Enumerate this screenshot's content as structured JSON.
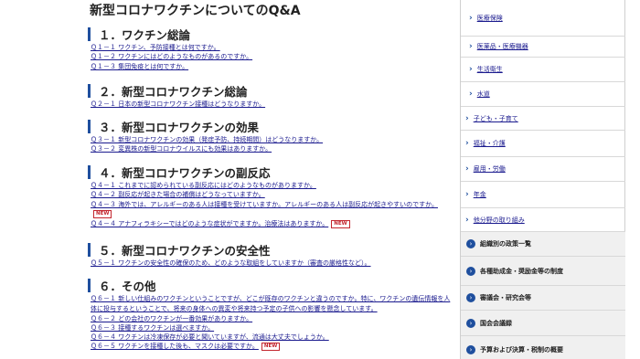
{
  "page_title": "新型コロナワクチンについてのQ&A",
  "new_badge": "NEW",
  "sections": [
    {
      "title": "１．ワクチン総論",
      "items": [
        "Ｑ１－１ ワクチン、予防接種とは何ですか。",
        "Ｑ１－２ ワクチンにはどのようなものがあるのですか。",
        "Ｑ１－３ 集団免疫とは何ですか。"
      ]
    },
    {
      "title": "２．新型コロナワクチン総論",
      "items": [
        "Ｑ２－１ 日本の新型コロナワクチン接種はどうなりますか。"
      ]
    },
    {
      "title": "３．新型コロナワクチンの効果",
      "items": [
        "Ｑ３－１ 新型コロナワクチンの効果（発症予防、持続期間）はどうなりますか。",
        "Ｑ３－２ 変異株の新型コロナウイルスにも効果はありますか。"
      ]
    },
    {
      "title": "４．新型コロナワクチンの副反応",
      "items": [
        "Ｑ４－１ これまでに認められている副反応にはどのようなものがありますか。",
        "Ｑ４－２ 副反応が起きた場合の補償はどうなっていますか。",
        "Ｑ４－３ 海外では、アレルギーのある人は接種を受けていますか。アレルギーのある人は副反応が起きやすいのですか。",
        "Ｑ４－４ アナフィラキシーではどのような症状がでますか。治療法はありますか。"
      ]
    },
    {
      "title": "５．新型コロナワクチンの安全性",
      "items": [
        "Ｑ５－１ ワクチンの安全性の確保のため、どのような取組をしていますか（審査の厳格性など）。"
      ]
    },
    {
      "title": "６．その他",
      "items": [
        "Ｑ６－１ 新しい仕組みのワクチンということですが、どこが既存のワクチンと違うのですか。特に、ワクチンの遺伝情報を人体に投与するということで、将来の身体への異変や将来持つ予定の子供への影響を懸念しています。",
        "Ｑ６－２ どの会社のワクチンが一番効果がありますか。",
        "Ｑ６－３ 接種するワクチンは選べますか。",
        "Ｑ６－４ ワクチンは冷凍保存が必要と聞いていますが、流通は大丈夫でしょうか。",
        "Ｑ６－５ ワクチンを接種した後も、マスクは必要ですか。"
      ]
    }
  ],
  "sidebar": {
    "sub_items": [
      "医療保険",
      "医薬品・医療機器",
      "生活衛生",
      "水道"
    ],
    "top_items": [
      "子ども・子育て",
      "福祉・介護",
      "雇用・労働",
      "年金",
      "他分野の取り組み"
    ],
    "categories": [
      "組織別の政策一覧",
      "各種助成金・奨励金等の制度",
      "審議会・研究会等",
      "国会会議録",
      "予算および決算・税制の概要"
    ]
  }
}
